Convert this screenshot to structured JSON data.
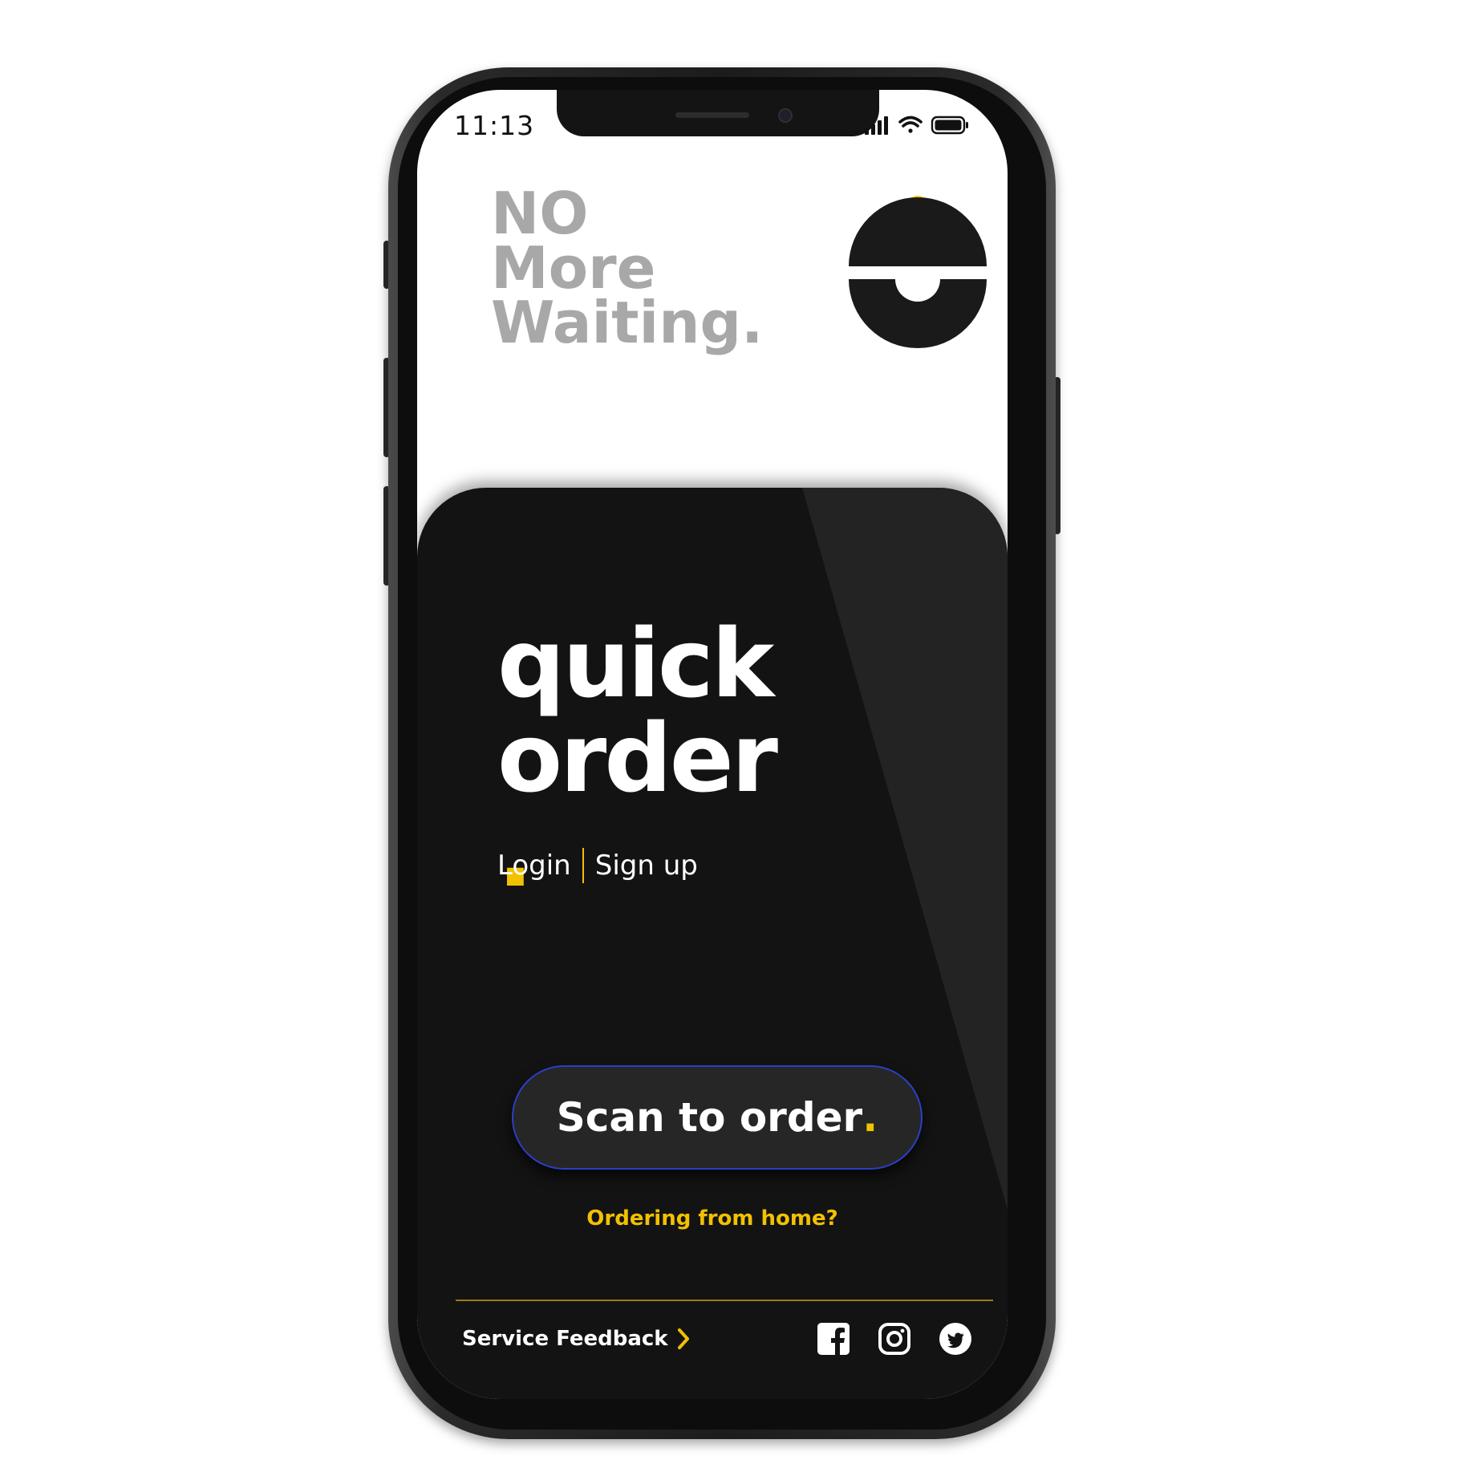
{
  "status_bar": {
    "time": "11:13"
  },
  "header": {
    "tagline": [
      "NO",
      "More",
      "Waiting."
    ]
  },
  "hero": {
    "title_line1": "quick",
    "title_line2": "order",
    "title_dot": "."
  },
  "auth": {
    "login": "Login",
    "signup": "Sign up"
  },
  "cta": {
    "label": "Scan to order",
    "dot": "."
  },
  "home_link": "Ordering from home?",
  "footer": {
    "feedback": "Service Feedback"
  },
  "icons": [
    "signal-icon",
    "wifi-icon",
    "battery-icon",
    "logo-icon",
    "chevron-right-icon",
    "facebook-icon",
    "instagram-icon",
    "twitter-icon"
  ],
  "colors": {
    "accent": "#f2c100",
    "card": "#131313",
    "button": "#262626",
    "button_border": "#2b3fc7",
    "tagline": "#a8a8a8"
  }
}
